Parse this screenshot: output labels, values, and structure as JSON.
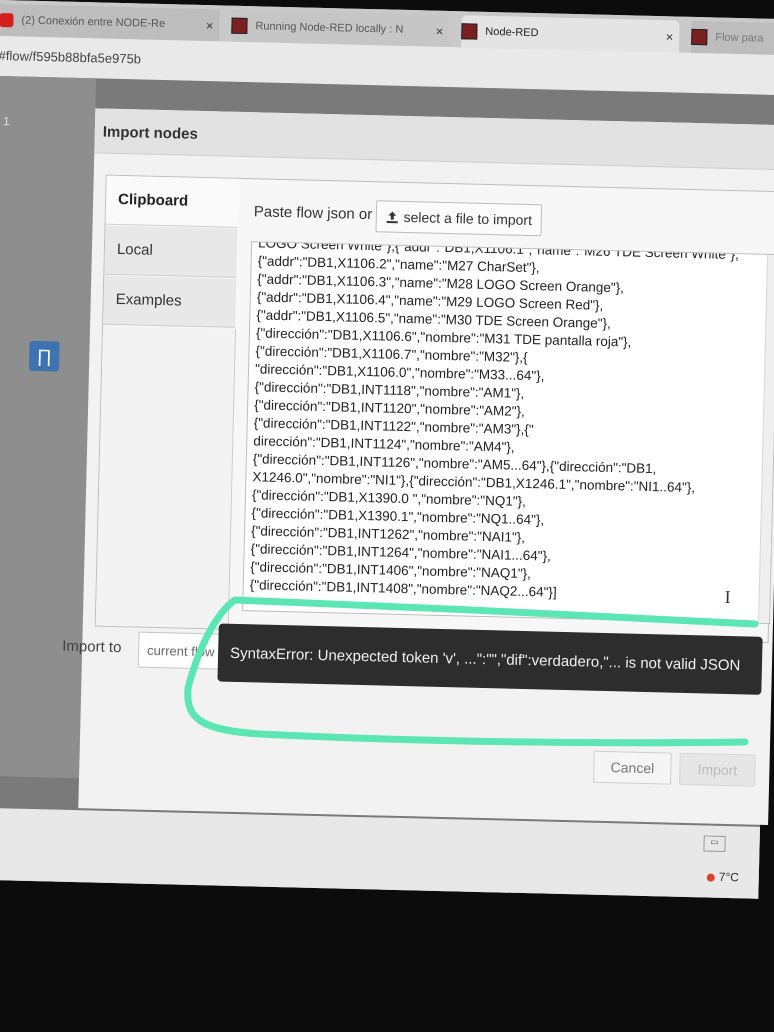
{
  "browser": {
    "tabs": [
      {
        "label": "(2) Conexión entre NODE-Re",
        "close": "×"
      },
      {
        "label": "Running Node-RED locally : N",
        "close": "×"
      },
      {
        "label": "Node-RED",
        "close": "×"
      },
      {
        "label": "Flow para"
      }
    ],
    "url": "#flow/f595b88bfa5e975b"
  },
  "workspace": {
    "tab_number": "1",
    "logo_glyph": "∏"
  },
  "dialog": {
    "title": "Import nodes",
    "side_tabs": [
      "Clipboard",
      "Local",
      "Examples"
    ],
    "paste_label": "Paste flow json or",
    "select_file_label": "select a file to import",
    "json_lines": [
      "LOGO Screen White\"},{\"addr\":\"DB1,X1106.1\",\"name\":\"M26 TDE Screen White\"},",
      "{\"addr\":\"DB1,X1106.2\",\"name\":\"M27 CharSet\"},",
      "{\"addr\":\"DB1,X1106.3\",\"name\":\"M28 LOGO Screen Orange\"},",
      "{\"addr\":\"DB1,X1106.4\",\"name\":\"M29 LOGO Screen Red\"},",
      "{\"addr\":\"DB1,X1106.5\",\"name\":\"M30 TDE Screen Orange\"},",
      "{\"dirección\":\"DB1,X1106.6\",\"nombre\":\"M31 TDE pantalla roja\"},",
      "{\"dirección\":\"DB1,X1106.7\",\"nombre\":\"M32\"},{",
      "\"dirección\":\"DB1,X1106.0\",\"nombre\":\"M33...64\"},",
      "{\"dirección\":\"DB1,INT1118\",\"nombre\":\"AM1\"},",
      "{\"dirección\":\"DB1,INT1120\",\"nombre\":\"AM2\"},",
      "{\"dirección\":\"DB1,INT1122\",\"nombre\":\"AM3\"},{\"",
      "dirección\":\"DB1,INT1124\",\"nombre\":\"AM4\"},",
      "{\"dirección\":\"DB1,INT1126\",\"nombre\":\"AM5...64\"},{\"dirección\":\"DB1,",
      "X1246.0\",\"nombre\":\"NI1\"},{\"dirección\":\"DB1,X1246.1\",\"nombre\":\"NI1..64\"},",
      "{\"dirección\":\"DB1,X1390.0 \",\"nombre\":\"NQ1\"},",
      "{\"dirección\":\"DB1,X1390.1\",\"nombre\":\"NQ1..64\"},",
      "{\"dirección\":\"DB1,INT1262\",\"nombre\":\"NAI1\"},",
      "{\"dirección\":\"DB1,INT1264\",\"nombre\":\"NAI1...64\"},",
      "{\"dirección\":\"DB1,INT1406\",\"nombre\":\"NAQ1\"},",
      "{\"dirección\":\"DB1,INT1408\",\"nombre\":\"NAQ2...64\"}]"
    ],
    "import_to_label": "Import to",
    "import_to_value": "current flow",
    "error": "SyntaxError: Unexpected token 'v', ...\":\"\",\"dif\":verdadero,\"... is not valid JSON",
    "cancel_label": "Cancel",
    "import_label": "Import"
  },
  "taskbar": {
    "temperature": "7°C"
  },
  "colors": {
    "highlight": "#5ce6b4",
    "tooltip_bg": "#2d2d2d",
    "node_red_logo": "#3d73b1"
  }
}
